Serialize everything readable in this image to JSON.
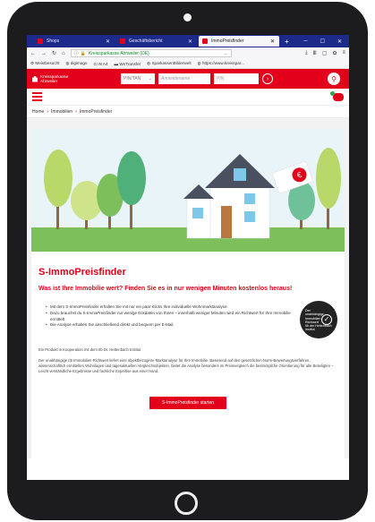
{
  "browser": {
    "tabs": [
      {
        "label": "Shops",
        "active": false
      },
      {
        "label": "Geschäftsbericht",
        "active": false
      },
      {
        "label": "ImmoPreisfinder",
        "active": true
      }
    ],
    "new_tab": "+",
    "url_text": "Kreissparkasse Ahrweiler (DE)",
    "url_more": "...",
    "bookmarks": [
      "Meistbesucht",
      "digimago",
      "IN A4",
      "WeTransfer",
      "SparkassenBilderwelt",
      "https://www.kreisspar..."
    ]
  },
  "site": {
    "brand_line1": "Kreissparkasse",
    "brand_line2": "Ahrweiler",
    "pin_select": "PIN/TAN",
    "login_placeholder": "Anmeldename",
    "pin_placeholder": "PIN",
    "breadcrumb": [
      "Home",
      "Immobilien",
      "ImmoPreisfinder"
    ]
  },
  "page": {
    "title": "S-ImmoPreisfinder",
    "subtitle": "Was ist Ihre Immobilie wert? Finden Sie es in nur wenigen Minuten kostenlos heraus!",
    "bullets": [
      "Mit dem S-ImmoPreisfinder erhalten Sie mit nur ein paar Klicks Ihre individuelle Wohnmarktanalyse.",
      "Dazu brauchst du S-ImmoPreisfinder nur wenige Eckdaten von Ihnen – innerhalb weniger Minuten wird ein Richtwert für Ihre Immobilie ermittelt.",
      "Die Analyse erhalten Sie anschließend direkt und bequem per E-Mail."
    ],
    "seal_text": [
      "Der",
      "unabhängige",
      "Immobilien",
      "Richtwert",
      "IIb der Hettenbach",
      "Institut"
    ],
    "cooperation_note": "Ein Produkt in Kooperation mit dem IIb Dr. Hettenbach Institut",
    "description": "Der unabhängige IIb Immobilien-Richtwert liefert eine objektbezogene Marktanalyse für Ihre Immobilie. Basierend auf den gesetzlichen Norm-Bewertungsverfahren, wissenschaftlich ermittelten Wohnlagen und tagesaktuellen Vergleichsobjekten, bietet die Analyse besonders im Preisvergleich die bestmögliche Orientierung für alle Beteiligten – Leicht verständliche Ergebnisse und fachliche Expertise aus einer Hand.",
    "cta": "S-ImmoPreisfinder starten"
  },
  "colors": {
    "accent": "#e2001a",
    "browser_tabbar": "#1e2a8a",
    "hero_sky": "#e8f4f7",
    "grass": "#7dbf5a"
  }
}
